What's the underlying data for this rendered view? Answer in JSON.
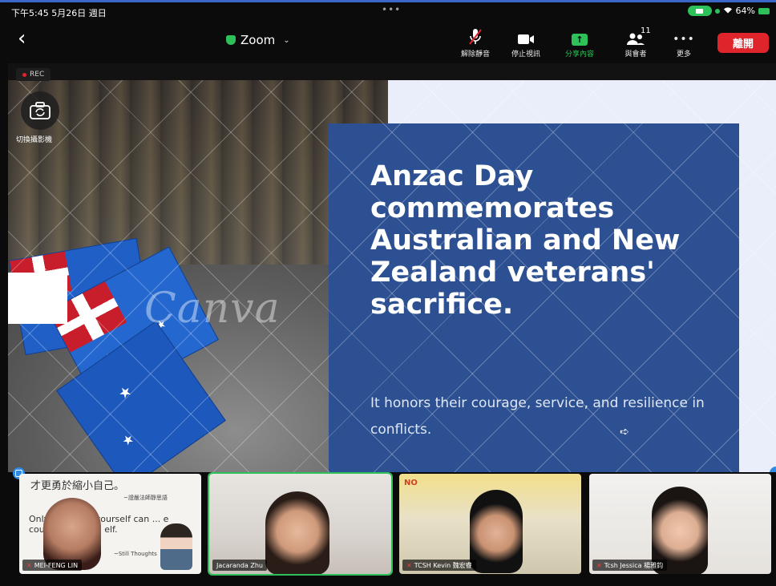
{
  "status_bar": {
    "time": "下午5:45  5月26日 週日",
    "dots": "•••",
    "battery": "64%"
  },
  "toolbar": {
    "title": "Zoom",
    "unmute_label": "解除靜音",
    "stop_video_label": "停止視訊",
    "share_label": "分享內容",
    "participants_label": "與會者",
    "participants_count": "11",
    "more_label": "更多",
    "leave_label": "離開"
  },
  "meeting": {
    "rec_label": "REC",
    "switch_camera_label": "切換攝影機"
  },
  "slide": {
    "watermark": "Canva",
    "title": "Anzac Day commemorates Australian and New Zealand veterans' sacrifice.",
    "subtitle": "It honors their courage, service, and resilience in conflicts."
  },
  "participants": [
    {
      "name": "MEI-FENG LIN",
      "muted": true,
      "quote_cn_line1": "才更勇於縮小自己。",
      "quote_cn_line2": "~證嚴法師靜思語",
      "quote_en": "Only ... espect yourself can ... e courage to hu ... elf.",
      "quote_sig": "~Still Thoughts"
    },
    {
      "name": "Jacaranda Zhu",
      "muted": false
    },
    {
      "name": "TCSH Kevin 魏宏睿",
      "muted": true,
      "poster": "NO"
    },
    {
      "name": "Tcsh Jessica 楊雅鈞",
      "muted": true
    }
  ],
  "colors": {
    "accent_green": "#2ec15a",
    "leave_red": "#e0242b",
    "slide_card": "#2c5091"
  }
}
